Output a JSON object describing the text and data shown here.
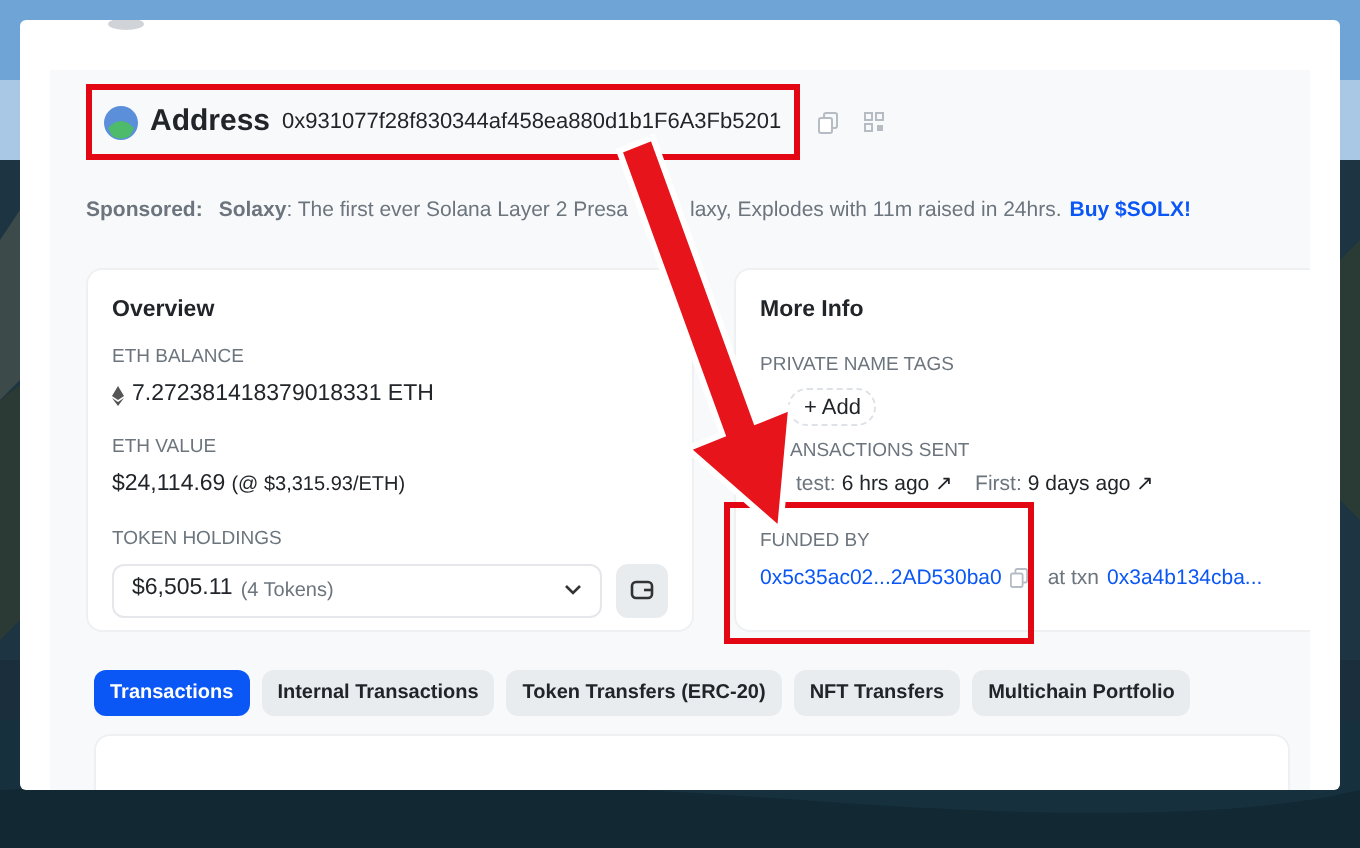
{
  "address_header": {
    "label": "Address",
    "address": "0x931077f28f830344af458ea880d1b1F6A3Fb5201"
  },
  "sponsored": {
    "label": "Sponsored:",
    "text_before": "**Solaxy**: The first ever Solana Layer 2 Presa",
    "text_after": "laxy, Explodes with 11m raised in 24hrs.",
    "link": "Buy $SOLX!"
  },
  "overview": {
    "title": "Overview",
    "fields": [
      {
        "kind": "balance",
        "label": "ETH BALANCE",
        "value": "7.272381418379018331 ETH"
      },
      {
        "kind": "value",
        "label": "ETH VALUE",
        "value": "$24,114.69",
        "note": "(@ $3,315.93/ETH)"
      },
      {
        "kind": "tokens",
        "label": "TOKEN HOLDINGS",
        "value": "$6,505.11",
        "note": "(4 Tokens)"
      }
    ]
  },
  "more_info": {
    "title": "More Info",
    "name_tags": {
      "label": "PRIVATE NAME TAGS",
      "button": "+ Add"
    },
    "transactions": {
      "label": "ANSACTIONS SENT",
      "latest_label": "test:",
      "latest": "6 hrs ago ↗",
      "first_label": "First:",
      "first": "9 days ago ↗"
    },
    "funded_by": {
      "label": "FUNDED BY",
      "address": "0x5c35ac02...2AD530ba0",
      "via": "at txn",
      "txn": "0x3a4b134cba..."
    }
  },
  "tabs": [
    {
      "label": "Transactions",
      "selected": true
    },
    {
      "label": "Internal Transactions",
      "selected": false
    },
    {
      "label": "Token Transfers (ERC-20)",
      "selected": false
    },
    {
      "label": "NFT Transfers",
      "selected": false
    },
    {
      "label": "Multichain Portfolio",
      "selected": false
    }
  ]
}
